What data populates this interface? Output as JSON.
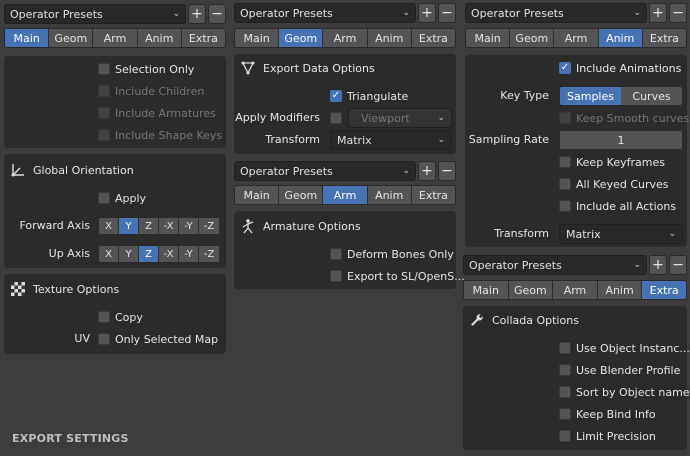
{
  "presets_label": "Operator Presets",
  "plus": "+",
  "minus": "−",
  "tabs": [
    "Main",
    "Geom",
    "Arm",
    "Anim",
    "Extra"
  ],
  "main": {
    "selection_only": "Selection Only",
    "include_children": "Include Children",
    "include_armatures": "Include Armatures",
    "include_shape_keys": "Include Shape Keys",
    "global_orientation": "Global Orientation",
    "apply": "Apply",
    "forward_axis": "Forward Axis",
    "up_axis": "Up Axis",
    "axes": [
      "X",
      "Y",
      "Z",
      "-X",
      "-Y",
      "-Z"
    ],
    "texture_options": "Texture Options",
    "copy": "Copy",
    "uv": "UV",
    "only_selected_map": "Only Selected Map"
  },
  "geom": {
    "export_data_options": "Export Data Options",
    "triangulate": "Triangulate",
    "apply_modifiers": "Apply Modifiers",
    "viewport": "Viewport",
    "transform": "Transform",
    "matrix": "Matrix"
  },
  "arm": {
    "armature_options": "Armature Options",
    "deform_bones_only": "Deform Bones Only",
    "export_to_sl": "Export to SL/OpenS..."
  },
  "anim": {
    "include_animations": "Include Animations",
    "key_type": "Key Type",
    "samples": "Samples",
    "curves": "Curves",
    "keep_smooth_curves": "Keep Smooth curves",
    "sampling_rate": "Sampling Rate",
    "sampling_rate_value": "1",
    "keep_keyframes": "Keep Keyframes",
    "all_keyed_curves": "All Keyed Curves",
    "include_all_actions": "Include all Actions",
    "transform": "Transform",
    "matrix": "Matrix"
  },
  "extra": {
    "collada_options": "Collada Options",
    "use_object_instances": "Use Object Instanc...",
    "use_blender_profile": "Use Blender Profile",
    "sort_by_object_name": "Sort by Object name",
    "keep_bind_info": "Keep Bind Info",
    "limit_precision": "Limit Precision"
  },
  "footer": "EXPORT SETTINGS",
  "colors": {
    "accent": "#4772b3",
    "panel": "#2b2b2b",
    "background": "#3d3d3d"
  }
}
